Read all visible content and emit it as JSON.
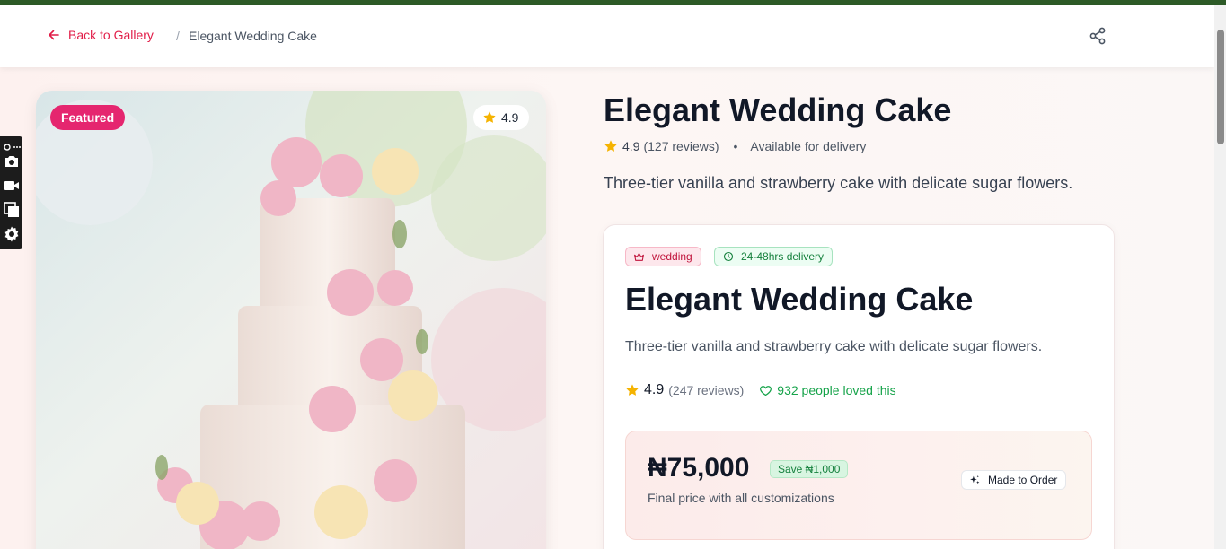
{
  "header": {
    "back_label": "Back to Gallery",
    "separator": "/",
    "breadcrumb_current": "Elegant Wedding Cake",
    "share_icon": "share-icon"
  },
  "image": {
    "featured_label": "Featured",
    "rating": "4.9"
  },
  "product": {
    "title": "Elegant Wedding Cake",
    "rating": "4.9",
    "reviews": "(127 reviews)",
    "dot": "•",
    "availability": "Available for delivery",
    "description": "Three-tier vanilla and strawberry cake with delicate sugar flowers."
  },
  "card": {
    "tag_category": "wedding",
    "tag_delivery": "24-48hrs delivery",
    "title": "Elegant Wedding Cake",
    "description": "Three-tier vanilla and strawberry cake with delicate sugar flowers.",
    "rating": "4.9",
    "reviews": "(247 reviews)",
    "loved": "932 people loved this",
    "price": "₦75,000",
    "save": "Save ₦1,000",
    "price_note": "Final price with all customizations",
    "made_badge": "Made to Order"
  },
  "colors": {
    "accent": "#e11d48",
    "featured": "#e5266f",
    "green": "#16a34a",
    "star": "#f5b301",
    "topbar": "#2d5a27"
  }
}
